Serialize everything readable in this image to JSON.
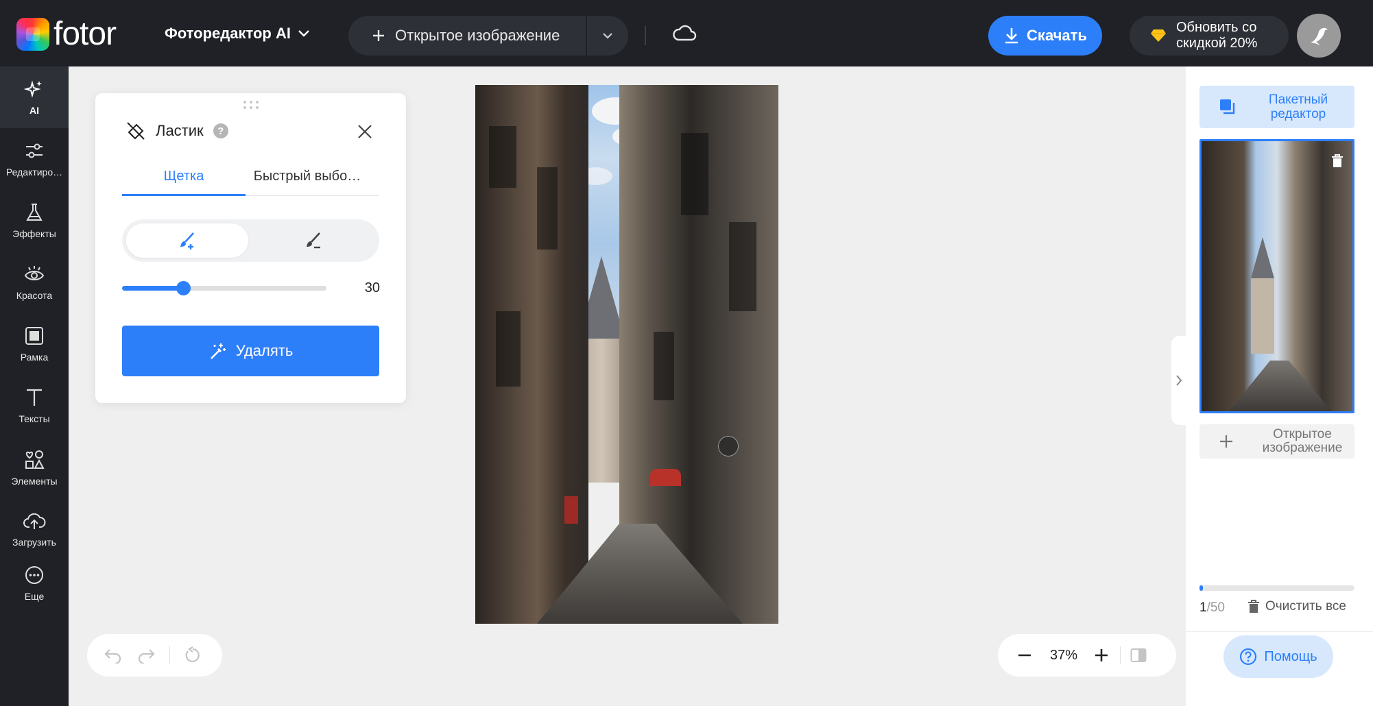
{
  "header": {
    "logo_text": "fotor",
    "editor_menu_label": "Фоторедактор AI",
    "open_image_label": "Открытое изображение",
    "download_label": "Скачать",
    "upgrade_line1": "Обновить со",
    "upgrade_line2": "скидкой 20%"
  },
  "sidebar": {
    "items": [
      {
        "label": "AI",
        "icon": "ai-sparkle-icon"
      },
      {
        "label": "Редактиро…",
        "icon": "sliders-icon"
      },
      {
        "label": "Эффекты",
        "icon": "flask-icon"
      },
      {
        "label": "Красота",
        "icon": "eye-icon"
      },
      {
        "label": "Рамка",
        "icon": "frame-icon"
      },
      {
        "label": "Тексты",
        "icon": "text-icon"
      },
      {
        "label": "Элементы",
        "icon": "shapes-icon"
      },
      {
        "label": "Загрузить",
        "icon": "upload-cloud-icon"
      },
      {
        "label": "Еще",
        "icon": "more-icon"
      }
    ]
  },
  "eraser_panel": {
    "title": "Ластик",
    "tabs": [
      "Щетка",
      "Быстрый выбо…"
    ],
    "active_tab": 0,
    "brush_size": 30,
    "brush_min": 0,
    "brush_max": 100,
    "erase_button_label": "Удалять"
  },
  "right_panel": {
    "batch_label": "Пакетный редактор",
    "add_image_label": "Открытое изображение",
    "count_current": "1",
    "count_total": "/50",
    "clear_all_label": "Очистить все",
    "help_label": "Помощь",
    "progress_fraction": 0.02
  },
  "zoom": {
    "value": "37%"
  },
  "colors": {
    "accent": "#2d7ff9",
    "topbar_bg": "#1f2126",
    "canvas_bg": "#efefef",
    "accent_light": "#d7e8fd"
  }
}
